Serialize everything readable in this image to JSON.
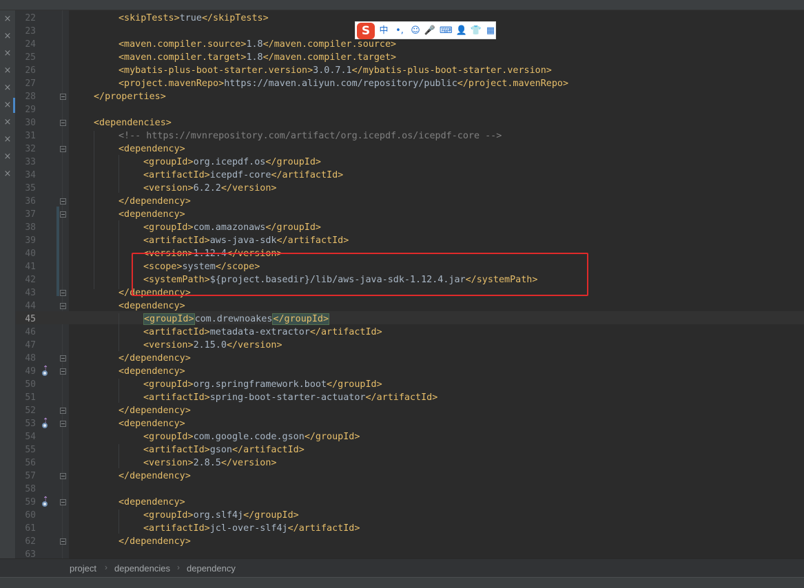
{
  "close_tab_glyph": "×",
  "lines": [
    {
      "num": "22",
      "parts": [
        {
          "c": "tag",
          "t": "<skipTests>"
        },
        {
          "c": "txt",
          "t": "true"
        },
        {
          "c": "tag",
          "t": "</skipTests>"
        }
      ]
    },
    {
      "num": "23",
      "parts": []
    },
    {
      "num": "24",
      "parts": [
        {
          "c": "tag",
          "t": "<maven.compiler.source>"
        },
        {
          "c": "txt",
          "t": "1.8"
        },
        {
          "c": "tag",
          "t": "</maven.compiler.source>"
        }
      ]
    },
    {
      "num": "25",
      "parts": [
        {
          "c": "tag",
          "t": "<maven.compiler.target>"
        },
        {
          "c": "txt",
          "t": "1.8"
        },
        {
          "c": "tag",
          "t": "</maven.compiler.target>"
        }
      ]
    },
    {
      "num": "26",
      "parts": [
        {
          "c": "tag",
          "t": "<mybatis-plus-boot-starter.version>"
        },
        {
          "c": "txt",
          "t": "3.0.7.1"
        },
        {
          "c": "tag",
          "t": "</mybatis-plus-boot-starter.version>"
        }
      ]
    },
    {
      "num": "27",
      "parts": [
        {
          "c": "tag",
          "t": "<project.mavenRepo>"
        },
        {
          "c": "txt",
          "t": "https://maven.aliyun.com/repository/public"
        },
        {
          "c": "tag",
          "t": "</project.mavenRepo>"
        }
      ]
    },
    {
      "num": "28",
      "parts": [
        {
          "c": "tag",
          "t": "</properties>"
        }
      ]
    },
    {
      "num": "29",
      "parts": []
    },
    {
      "num": "30",
      "parts": [
        {
          "c": "tag",
          "t": "<dependencies>"
        }
      ]
    },
    {
      "num": "31",
      "parts": [
        {
          "c": "cmt",
          "t": "<!-- https://mvnrepository.com/artifact/org.icepdf.os/icepdf-core -->"
        }
      ]
    },
    {
      "num": "32",
      "parts": [
        {
          "c": "tag",
          "t": "<dependency>"
        }
      ]
    },
    {
      "num": "33",
      "parts": [
        {
          "c": "tag",
          "t": "<groupId>"
        },
        {
          "c": "txt",
          "t": "org.icepdf.os"
        },
        {
          "c": "tag",
          "t": "</groupId>"
        }
      ]
    },
    {
      "num": "34",
      "parts": [
        {
          "c": "tag",
          "t": "<artifactId>"
        },
        {
          "c": "txt",
          "t": "icepdf-core"
        },
        {
          "c": "tag",
          "t": "</artifactId>"
        }
      ]
    },
    {
      "num": "35",
      "parts": [
        {
          "c": "tag",
          "t": "<version>"
        },
        {
          "c": "txt",
          "t": "6.2.2"
        },
        {
          "c": "tag",
          "t": "</version>"
        }
      ]
    },
    {
      "num": "36",
      "parts": [
        {
          "c": "tag",
          "t": "</dependency>"
        }
      ]
    },
    {
      "num": "37",
      "parts": [
        {
          "c": "tag",
          "t": "<dependency>"
        }
      ]
    },
    {
      "num": "38",
      "parts": [
        {
          "c": "tag",
          "t": "<groupId>"
        },
        {
          "c": "txt",
          "t": "com.amazonaws"
        },
        {
          "c": "tag",
          "t": "</groupId>"
        }
      ]
    },
    {
      "num": "39",
      "parts": [
        {
          "c": "tag",
          "t": "<artifactId>"
        },
        {
          "c": "txt",
          "t": "aws-java-sdk"
        },
        {
          "c": "tag",
          "t": "</artifactId>"
        }
      ]
    },
    {
      "num": "40",
      "parts": [
        {
          "c": "tag",
          "t": "<version>"
        },
        {
          "c": "txt",
          "t": "1.12.4"
        },
        {
          "c": "tag",
          "t": "</version>"
        }
      ]
    },
    {
      "num": "41",
      "parts": [
        {
          "c": "tag",
          "t": "<scope>"
        },
        {
          "c": "txt",
          "t": "system"
        },
        {
          "c": "tag",
          "t": "</scope>"
        }
      ]
    },
    {
      "num": "42",
      "parts": [
        {
          "c": "tag",
          "t": "<systemPath>"
        },
        {
          "c": "txt",
          "t": "${project.basedir}/lib/aws-java-sdk-1.12.4.jar"
        },
        {
          "c": "tag",
          "t": "</systemPath>"
        }
      ]
    },
    {
      "num": "43",
      "parts": [
        {
          "c": "tag",
          "t": "</dependency>"
        }
      ]
    },
    {
      "num": "44",
      "parts": [
        {
          "c": "tag",
          "t": "<dependency>"
        }
      ]
    },
    {
      "num": "45",
      "parts": [
        {
          "c": "tag mt",
          "t": "<groupId>"
        },
        {
          "c": "txt",
          "t": "com.drewnoakes"
        },
        {
          "c": "tag mt",
          "t": "</groupId>"
        }
      ]
    },
    {
      "num": "46",
      "parts": [
        {
          "c": "tag",
          "t": "<artifactId>"
        },
        {
          "c": "txt",
          "t": "metadata-extractor"
        },
        {
          "c": "tag",
          "t": "</artifactId>"
        }
      ]
    },
    {
      "num": "47",
      "parts": [
        {
          "c": "tag",
          "t": "<version>"
        },
        {
          "c": "txt",
          "t": "2.15.0"
        },
        {
          "c": "tag",
          "t": "</version>"
        }
      ]
    },
    {
      "num": "48",
      "parts": [
        {
          "c": "tag",
          "t": "</dependency>"
        }
      ]
    },
    {
      "num": "49",
      "parts": [
        {
          "c": "tag",
          "t": "<dependency>"
        }
      ]
    },
    {
      "num": "50",
      "parts": [
        {
          "c": "tag",
          "t": "<groupId>"
        },
        {
          "c": "txt",
          "t": "org.springframework.boot"
        },
        {
          "c": "tag",
          "t": "</groupId>"
        }
      ]
    },
    {
      "num": "51",
      "parts": [
        {
          "c": "tag",
          "t": "<artifactId>"
        },
        {
          "c": "txt",
          "t": "spring-boot-starter-actuator"
        },
        {
          "c": "tag",
          "t": "</artifactId>"
        }
      ]
    },
    {
      "num": "52",
      "parts": [
        {
          "c": "tag",
          "t": "</dependency>"
        }
      ]
    },
    {
      "num": "53",
      "parts": [
        {
          "c": "tag",
          "t": "<dependency>"
        }
      ]
    },
    {
      "num": "54",
      "parts": [
        {
          "c": "tag",
          "t": "<groupId>"
        },
        {
          "c": "txt",
          "t": "com.google.code.gson"
        },
        {
          "c": "tag",
          "t": "</groupId>"
        }
      ]
    },
    {
      "num": "55",
      "parts": [
        {
          "c": "tag",
          "t": "<artifactId>"
        },
        {
          "c": "txt",
          "t": "gson"
        },
        {
          "c": "tag",
          "t": "</artifactId>"
        }
      ]
    },
    {
      "num": "56",
      "parts": [
        {
          "c": "tag",
          "t": "<version>"
        },
        {
          "c": "txt",
          "t": "2.8.5"
        },
        {
          "c": "tag",
          "t": "</version>"
        }
      ]
    },
    {
      "num": "57",
      "parts": [
        {
          "c": "tag",
          "t": "</dependency>"
        }
      ]
    },
    {
      "num": "58",
      "parts": []
    },
    {
      "num": "59",
      "parts": [
        {
          "c": "tag",
          "t": "<dependency>"
        }
      ]
    },
    {
      "num": "60",
      "parts": [
        {
          "c": "tag",
          "t": "<groupId>"
        },
        {
          "c": "txt",
          "t": "org.slf4j"
        },
        {
          "c": "tag",
          "t": "</groupId>"
        }
      ]
    },
    {
      "num": "61",
      "parts": [
        {
          "c": "tag",
          "t": "<artifactId>"
        },
        {
          "c": "txt",
          "t": "jcl-over-slf4j"
        },
        {
          "c": "tag",
          "t": "</artifactId>"
        }
      ]
    },
    {
      "num": "62",
      "parts": [
        {
          "c": "tag",
          "t": "</dependency>"
        }
      ]
    },
    {
      "num": "63",
      "parts": []
    }
  ],
  "ime_toolbar": {
    "logo": "S",
    "items": [
      {
        "name": "chinese-mode",
        "glyph": "中"
      },
      {
        "name": "punctuation",
        "glyph": "•,"
      },
      {
        "name": "emoji-icon",
        "glyph": "☺"
      },
      {
        "name": "microphone-icon",
        "glyph": "🎤"
      },
      {
        "name": "keyboard-icon",
        "glyph": "⌨"
      },
      {
        "name": "user-icon",
        "glyph": "👤"
      },
      {
        "name": "skin-icon",
        "glyph": "👕"
      },
      {
        "name": "menu-grid-icon",
        "glyph": "▦"
      }
    ]
  },
  "breadcrumb": {
    "items": [
      "project",
      "dependencies",
      "dependency"
    ],
    "separator": "›"
  }
}
